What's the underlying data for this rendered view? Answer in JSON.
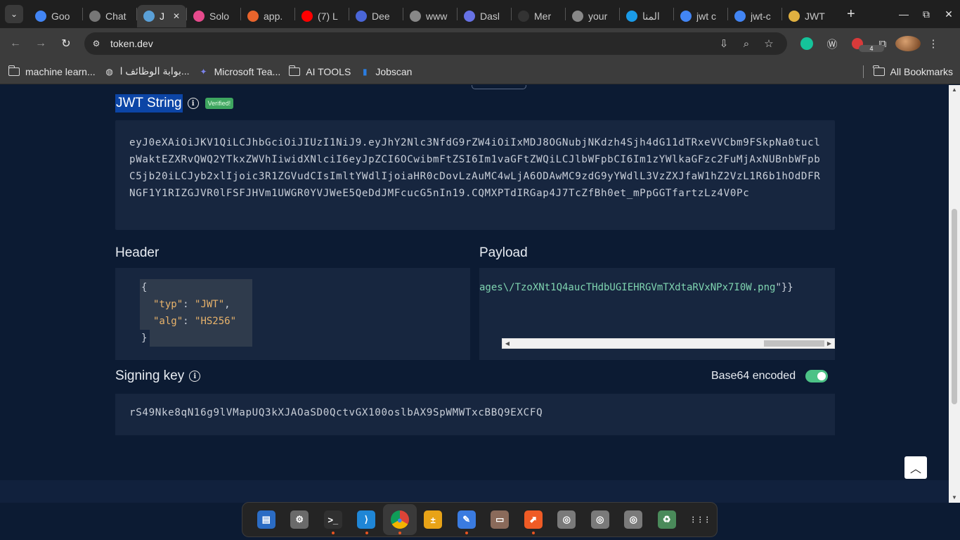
{
  "browser": {
    "tabs": [
      {
        "title": "Goo",
        "favicon": "google-translate-icon",
        "color": "#4285f4"
      },
      {
        "title": "Chat",
        "favicon": "chatgpt-icon",
        "color": "#777777"
      },
      {
        "title": "J",
        "favicon": "jwt-shield-icon",
        "color": "#5aa0d8",
        "active": true
      },
      {
        "title": "Solo",
        "favicon": "solo-icon",
        "color": "#e64a8c"
      },
      {
        "title": "app.",
        "favicon": "app-icon",
        "color": "#e8642c"
      },
      {
        "title": "(7) L",
        "favicon": "youtube-icon",
        "color": "#ff0000"
      },
      {
        "title": "Dee",
        "favicon": "deepl-icon",
        "color": "#4a66d8"
      },
      {
        "title": "www",
        "favicon": "globe-icon",
        "color": "#888888"
      },
      {
        "title": "Dasl",
        "favicon": "stripe-icon",
        "color": "#6772e5"
      },
      {
        "title": "Mer",
        "favicon": "github-icon",
        "color": "#333333"
      },
      {
        "title": "your",
        "favicon": "globe-icon",
        "color": "#888888"
      },
      {
        "title": "المنا",
        "favicon": "circle-icon",
        "color": "#1a9be8"
      },
      {
        "title": "jwt c",
        "favicon": "google-icon",
        "color": "#4285f4"
      },
      {
        "title": "jwt-c",
        "favicon": "google-icon",
        "color": "#4285f4"
      },
      {
        "title": "JWT",
        "favicon": "shield-icon",
        "color": "#e0b040"
      }
    ],
    "close_glyph": "✕",
    "new_tab_glyph": "+",
    "url": "token.dev",
    "bookmarks": [
      {
        "label": "machine learn...",
        "icon": "folder-icon"
      },
      {
        "label": "بوابة الوظائف ا...",
        "icon": "globe-icon"
      },
      {
        "label": "Microsoft Tea...",
        "icon": "teams-icon"
      },
      {
        "label": "AI TOOLS",
        "icon": "folder-icon"
      },
      {
        "label": "Jobscan",
        "icon": "jobscan-icon"
      }
    ],
    "all_bookmarks": "All Bookmarks",
    "extension_badge": "4"
  },
  "page": {
    "jwt_title": "JWT String",
    "verified_badge": "Verified!",
    "token": "eyJ0eXAiOiJKV1QiLCJhbGciOiJIUzI1NiJ9.eyJhY2Nlc3NfdG9rZW4iOiIxMDJ8OGNubjNKdzh4Sjh4dG11dTRxeVVCbm9FSkpNa0tuclpWaktEZXRvQWQ2YTkxZWVhIiwidXNlciI6eyJpZCI6OCwibmFtZSI6Im1vaGFtZWQiLCJlbWFpbCI6Im1zYWlkaGFzc2FuMjAxNUBnbWFpbC5jb20iLCJyb2xlIjoic3R1ZGVudCIsImltYWdlIjoiaHR0cDovLzAuMC4wLjA6ODAwMC9zdG9yYWdlL3VzZXJfaW1hZ2VzL1R6b1hOdDFRNGF1Y1RIZGJVR0lFSFJHVm1UWGR0YVJWeE5QeDdJMFcucG5nIn19.CQMXPTdIRGap4J7TcZfBh0et_mPpGGTfartzLz4V0Pc",
    "header_label": "Header",
    "header": {
      "open": "{",
      "typ_key": "\"typ\"",
      "typ_val": "\"JWT\"",
      "alg_key": "\"alg\"",
      "alg_val": "\"HS256\"",
      "close": "}"
    },
    "payload_label": "Payload",
    "payload_visible": "ages\\/TzoXNt1Q4aucTHdbUGIEHRGVmTXdtaRVxNPx7I0W.png",
    "payload_tail": "\"}}",
    "signing_label": "Signing key",
    "base64_label": "Base64 encoded",
    "base64_enabled": true,
    "signing_key": "rS49Nke8qN16g9lVMapUQ3kXJAOaSD0QctvGX100oslbAX9SpWMWTxcBBQ9EXCFQ"
  },
  "dock": {
    "apps": [
      {
        "name": "text-editor",
        "running": false
      },
      {
        "name": "settings",
        "running": false
      },
      {
        "name": "terminal",
        "running": true
      },
      {
        "name": "vscode",
        "running": true
      },
      {
        "name": "chrome",
        "running": true,
        "active": true
      },
      {
        "name": "calculator",
        "running": false
      },
      {
        "name": "notes",
        "running": true
      },
      {
        "name": "files",
        "running": false
      },
      {
        "name": "postman",
        "running": true
      },
      {
        "name": "disk-1",
        "running": false
      },
      {
        "name": "disk-2",
        "running": false
      },
      {
        "name": "disk-3",
        "running": false
      },
      {
        "name": "trash",
        "running": false
      },
      {
        "name": "app-grid",
        "running": false
      }
    ]
  }
}
